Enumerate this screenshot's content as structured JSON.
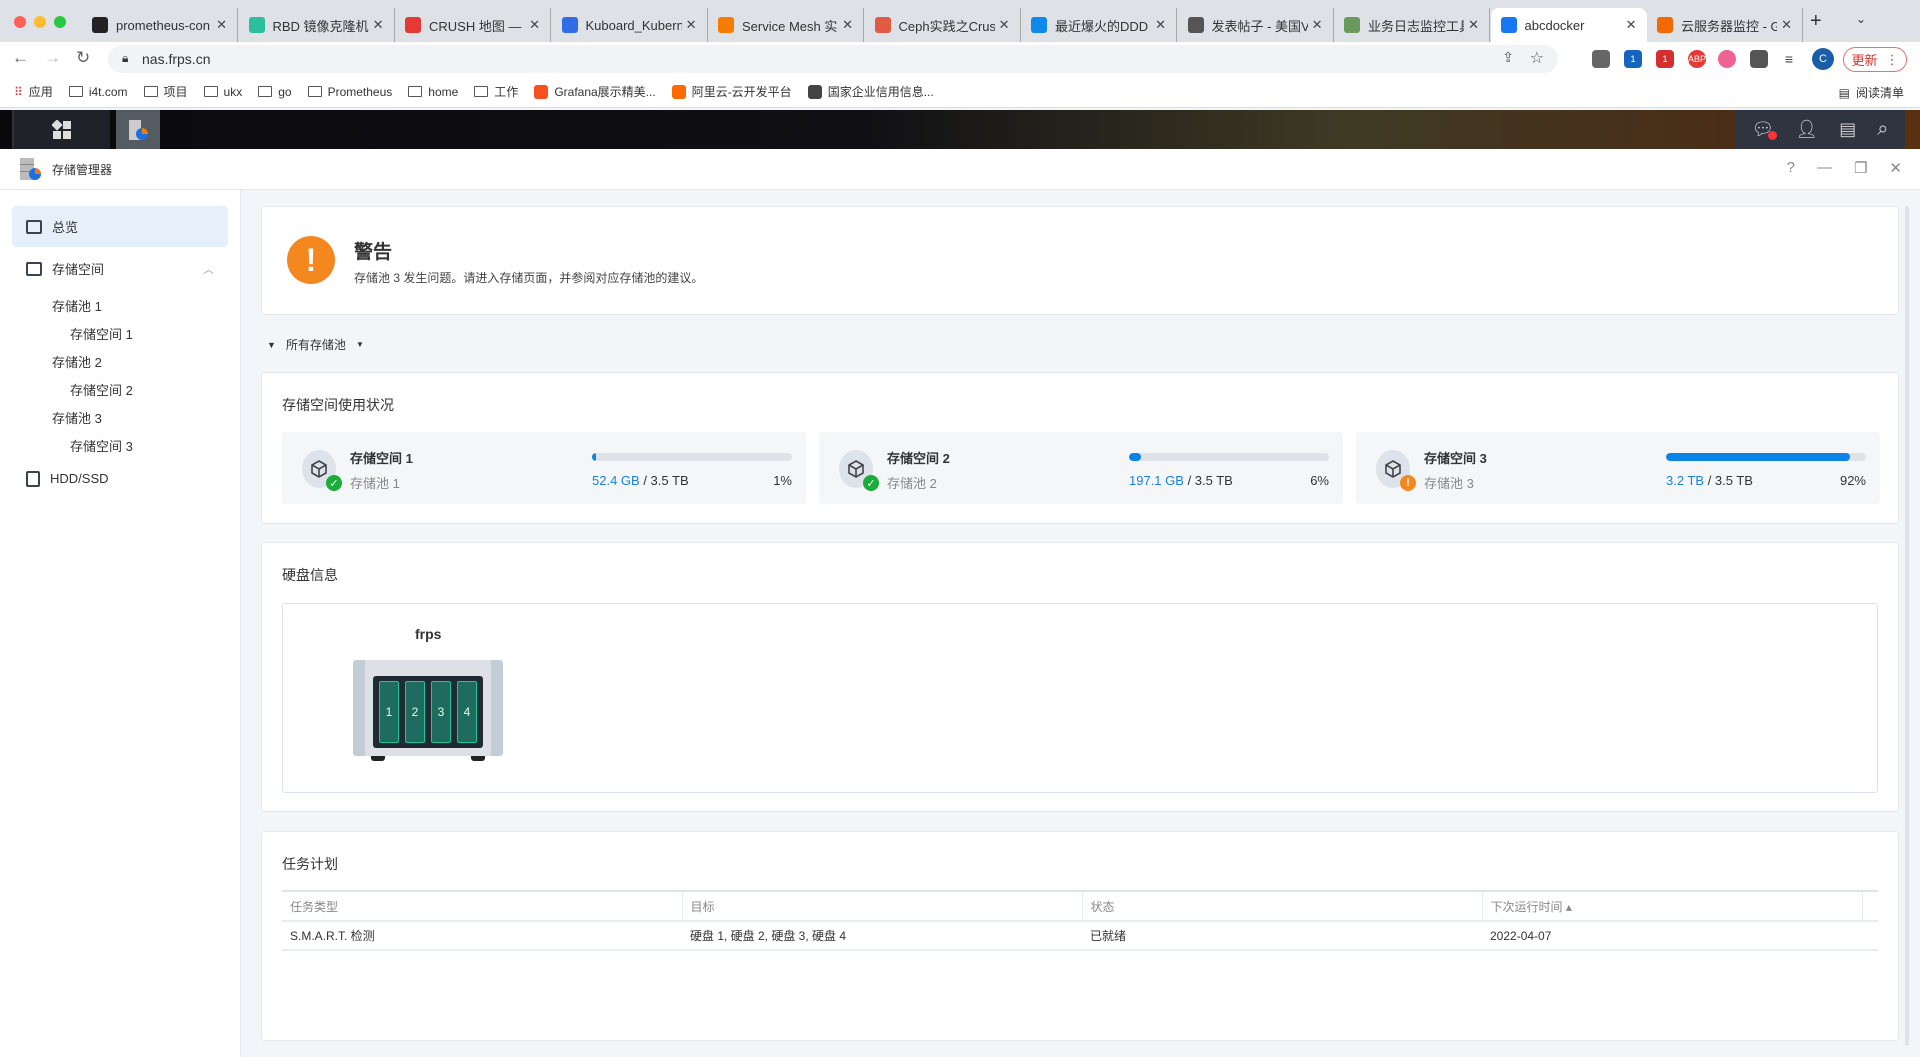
{
  "browser": {
    "tabs": [
      {
        "title": "prometheus-con",
        "icon": "github-icon",
        "color": "#222"
      },
      {
        "title": "RBD 镜像克隆机制",
        "icon": "c-icon",
        "color": "#2bbf9b"
      },
      {
        "title": "CRUSH 地图 — C",
        "icon": "ceph-icon",
        "color": "#e53935"
      },
      {
        "title": "Kuboard_Kubern",
        "icon": "kuboard-icon",
        "color": "#2f6ce5"
      },
      {
        "title": "Service Mesh 实",
        "icon": "istio-icon",
        "color": "#f57c00"
      },
      {
        "title": "Ceph实践之Crus",
        "icon": "jianshu-icon",
        "color": "#e05a44"
      },
      {
        "title": "最近爆火的DDD",
        "icon": "zhihu-icon",
        "color": "#0f88eb"
      },
      {
        "title": "发表帖子 - 美国V",
        "icon": "avatar-icon",
        "color": "#555"
      },
      {
        "title": "业务日志监控工具",
        "icon": "plant-icon",
        "color": "#6a9a5b"
      },
      {
        "title": "abcdocker",
        "icon": "dsm-icon",
        "color": "#1877f2"
      },
      {
        "title": "云服务器监控 - G",
        "icon": "grafana-icon",
        "color": "#f46800"
      }
    ],
    "active_tab": 9,
    "url": "nas.frps.cn",
    "update_label": "更新",
    "profile_initial": "C",
    "ext_badges": [
      "1",
      "1"
    ],
    "ext_abp": "ABP",
    "bookmarks": [
      "应用",
      "i4t.com",
      "项目",
      "ukx",
      "go",
      "Prometheus",
      "home",
      "工作",
      "Grafana展示精美...",
      "阿里云-云开发平台",
      "国家企业信用信息..."
    ],
    "reading_list": "阅读清单"
  },
  "window": {
    "title": "存储管理器",
    "help": "?"
  },
  "sidebar": {
    "overview": "总览",
    "storage": "存储空间",
    "items": [
      {
        "label": "存储池 1",
        "level": 1
      },
      {
        "label": "存储空间 1",
        "level": 2
      },
      {
        "label": "存储池 2",
        "level": 1
      },
      {
        "label": "存储空间 2",
        "level": 2
      },
      {
        "label": "存储池 3",
        "level": 1
      },
      {
        "label": "存储空间 3",
        "level": 2
      }
    ],
    "hdd": "HDD/SSD"
  },
  "warning": {
    "title": "警告",
    "message": "存储池 3 发生问题。请进入存储页面，并参阅对应存储池的建议。"
  },
  "filter": {
    "label": "所有存储池"
  },
  "usage": {
    "title": "存储空间使用状况",
    "volumes": [
      {
        "name": "存储空间 1",
        "pool": "存储池 1",
        "used": "52.4 GB",
        "total": "/ 3.5 TB",
        "percent": "1%",
        "fill": 1,
        "status": "ok"
      },
      {
        "name": "存储空间 2",
        "pool": "存储池 2",
        "used": "197.1 GB",
        "total": "/ 3.5 TB",
        "percent": "6%",
        "fill": 6,
        "status": "ok"
      },
      {
        "name": "存储空间 3",
        "pool": "存储池 3",
        "used": "3.2 TB",
        "total": "/ 3.5 TB",
        "percent": "92%",
        "fill": 92,
        "status": "warning"
      }
    ]
  },
  "disks": {
    "title": "硬盘信息",
    "nas_name": "frps",
    "bays": [
      "1",
      "2",
      "3",
      "4"
    ]
  },
  "tasks": {
    "title": "任务计划",
    "columns": [
      "任务类型",
      "目标",
      "状态",
      "下次运行时间 ▴"
    ],
    "rows": [
      [
        "S.M.A.R.T. 检测",
        "硬盘 1, 硬盘 2, 硬盘 3, 硬盘 4",
        "已就绪",
        "2022-04-07"
      ]
    ]
  },
  "colors": {
    "accent": "#0a84e5",
    "warning": "#f5871f",
    "ok": "#1aad3a"
  }
}
